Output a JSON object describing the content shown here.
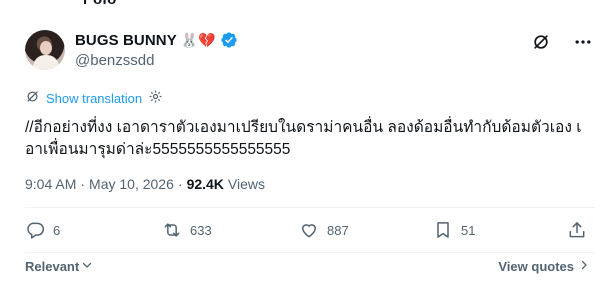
{
  "top_partial_text": "r ofo",
  "author": {
    "display_name": "BUGS BUNNY",
    "name_emojis": "🐰💔",
    "handle": "@benzssdd",
    "verified": true
  },
  "translate": {
    "label": "Show translation"
  },
  "tweet": {
    "text": "//อีกอย่างที่งง เอาดาราตัวเองมาเปรียบในดราม่าคนอื่น ลองด้อมอื่นทำกับด้อมตัวเอง เอาเพื่อนมารุมด่าล่ะ5555555555555555"
  },
  "meta": {
    "time": "9:04 AM",
    "separator": "·",
    "date": "May 10, 2026",
    "views_count": "92.4K",
    "views_label": "Views"
  },
  "actions": {
    "replies": "6",
    "reposts": "633",
    "likes": "887",
    "bookmarks": "51"
  },
  "footer": {
    "sort_label": "Relevant",
    "view_quotes_label": "View quotes"
  },
  "colors": {
    "accent": "#1d9bf0",
    "text": "#0f1419",
    "muted": "#536471",
    "divider": "#eff3f4"
  }
}
